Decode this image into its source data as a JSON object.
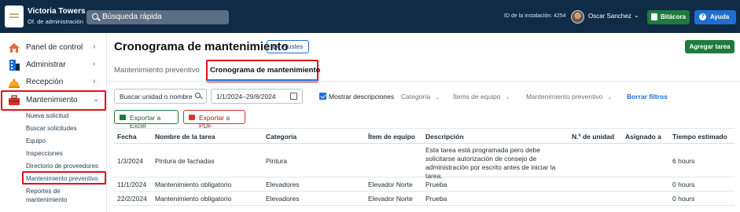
{
  "org": {
    "name": "Victoria Towers",
    "subtitle": "Of. de administración"
  },
  "search": {
    "placeholder": "Búsqueda rápida"
  },
  "header": {
    "installation_id": "ID de la instalación: 4254",
    "user_name": "Oscar Sanchez",
    "bitacora_label": "Bitácora",
    "ayuda_label": "Ayuda"
  },
  "sidebar": {
    "items": [
      {
        "label": "Panel de control",
        "icon": "dashboard-icon"
      },
      {
        "label": "Administrar",
        "icon": "building-icon"
      },
      {
        "label": "Recepción",
        "icon": "bell-icon"
      },
      {
        "label": "Mantenimiento",
        "icon": "toolbox-icon"
      }
    ],
    "subitems": [
      "Nueva solicitud",
      "Buscar solicitudes",
      "Equipo",
      "Inspecciones",
      "Directorio de proveedores",
      "Mantenimiento preventivo",
      "Reportes de",
      "mantenimiento"
    ]
  },
  "page": {
    "title": "Cronograma de mantenimiento",
    "ajustes_label": "Ajustes",
    "add_task_label": "Agregar tarea"
  },
  "tabs": [
    "Mantenimiento preventivo",
    "Cronograma de mantenimiento"
  ],
  "filters": {
    "search_placeholder": "Buscar unidad o nombre",
    "date_range": "1/1/2024–29/8/2024",
    "show_descriptions_label": "Mostrar descripciones",
    "category_label": "Categoría",
    "equipment_label": "Ítems de equipo",
    "type_label": "Mantenimiento preventivo",
    "clear_label": "Borrar filtros"
  },
  "export": {
    "excel_label": "Exportar a Excel",
    "pdf_label": "Exportar a PDF"
  },
  "table": {
    "columns": [
      "Fecha",
      "Nombre de la tarea",
      "Categoría",
      "Ítem de equipo",
      "Descripción",
      "N.º de unidad",
      "Asignado a",
      "Tiempo estimado"
    ],
    "rows": [
      [
        "1/3/2024",
        "Pintura de fachadas",
        "Pintura",
        "",
        "Esta tarea está programada pero debe solicitarse autorización de consejo de administración por escrito antes de iniciar la tarea.",
        "",
        "",
        "6 hours"
      ],
      [
        "11/1/2024",
        "Mantenimiento obligatorio",
        "Elevadores",
        "Elevador Norte",
        "Prueba",
        "",
        "",
        "0 hours"
      ],
      [
        "22/2/2024",
        "Mantenimiento obligatorio",
        "Elevadores",
        "Elevador Norte",
        "Prueba",
        "",
        "",
        "0 hours"
      ]
    ]
  },
  "colors": {
    "topbar": "#0f2b46",
    "green": "#1f7a3d",
    "blue": "#1d6fd1",
    "highlight": "#e3101a"
  }
}
